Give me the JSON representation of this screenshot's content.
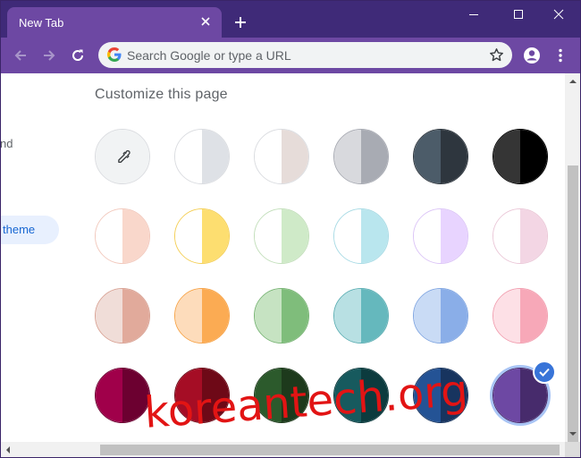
{
  "tab": {
    "title": "New Tab"
  },
  "omnibox": {
    "placeholder": "Search Google or type a URL"
  },
  "sidebar": {
    "partial_item": "nd",
    "active_item": "theme"
  },
  "page": {
    "title": "Customize this page"
  },
  "themes": [
    [
      {
        "name": "custom-color",
        "left": "#f1f3f4",
        "right": "#f1f3f4",
        "border": "#dadce0"
      },
      {
        "name": "default-white",
        "left": "#ffffff",
        "right": "#dee1e6",
        "border": "#dadce0"
      },
      {
        "name": "warm-grey",
        "left": "#ffffff",
        "right": "#e6dcd9",
        "border": "#dadce0"
      },
      {
        "name": "cool-grey",
        "left": "#d8d9dd",
        "right": "#a8abb3",
        "border": "#a8abb3"
      },
      {
        "name": "slate",
        "left": "#4c5c69",
        "right": "#2e363e",
        "border": "#2e363e"
      },
      {
        "name": "black",
        "left": "#353535",
        "right": "#000000",
        "border": "#000000"
      }
    ],
    [
      {
        "name": "peach",
        "left": "#ffffff",
        "right": "#f9d7cb",
        "border": "#f2c9bd"
      },
      {
        "name": "yellow",
        "left": "#ffffff",
        "right": "#fdde70",
        "border": "#f4cf57"
      },
      {
        "name": "mint",
        "left": "#ffffff",
        "right": "#cfeac8",
        "border": "#c3dfbb"
      },
      {
        "name": "aqua",
        "left": "#ffffff",
        "right": "#b9e6ee",
        "border": "#a9dbe5"
      },
      {
        "name": "lavender",
        "left": "#ffffff",
        "right": "#e8d4ff",
        "border": "#dcc5f7"
      },
      {
        "name": "pink",
        "left": "#ffffff",
        "right": "#f3d6e4",
        "border": "#ebc8d8"
      }
    ],
    [
      {
        "name": "rose-beige",
        "left": "#f0ddd8",
        "right": "#e1aa9b",
        "border": "#d9a395"
      },
      {
        "name": "orange",
        "left": "#fddcbb",
        "right": "#fbab53",
        "border": "#f7a449"
      },
      {
        "name": "green",
        "left": "#c6e3c2",
        "right": "#7fbd7b",
        "border": "#79b575"
      },
      {
        "name": "teal",
        "left": "#b8e0e3",
        "right": "#65b8bd",
        "border": "#5fb0b5"
      },
      {
        "name": "blue",
        "left": "#c9dbf5",
        "right": "#8aaee8",
        "border": "#82a7e2"
      },
      {
        "name": "light-pink",
        "left": "#fde0e6",
        "right": "#f7a8b8",
        "border": "#f2a0b1"
      }
    ],
    [
      {
        "name": "wine",
        "left": "#a0004a",
        "right": "#6c0030",
        "border": "#6c0030"
      },
      {
        "name": "crimson",
        "left": "#a50d25",
        "right": "#6e0917",
        "border": "#6e0917"
      },
      {
        "name": "forest",
        "left": "#2c5a2c",
        "right": "#1d3a1c",
        "border": "#1d3a1c"
      },
      {
        "name": "deep-teal",
        "left": "#175a5e",
        "right": "#0c3b3e",
        "border": "#0c3b3e"
      },
      {
        "name": "navy",
        "left": "#245395",
        "right": "#17345f",
        "border": "#17345f"
      },
      {
        "name": "purple",
        "left": "#6d48a3",
        "right": "#472b6c",
        "border": "#472b6c",
        "selected": true
      }
    ]
  ],
  "watermark": "koreantech.org"
}
